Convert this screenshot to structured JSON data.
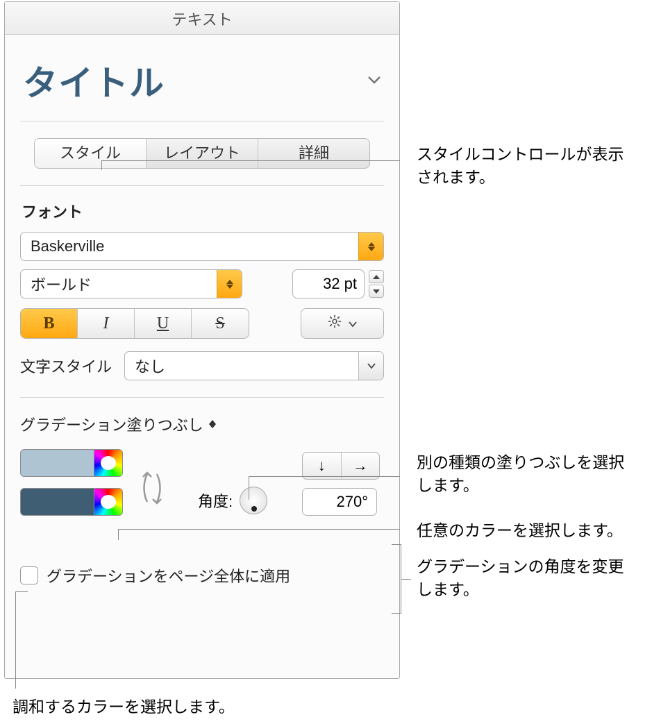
{
  "panel_title": "テキスト",
  "paragraph_style": "タイトル",
  "tabs": {
    "style": "スタイル",
    "layout": "レイアウト",
    "more": "詳細"
  },
  "font": {
    "section_label": "フォント",
    "family": "Baskerville",
    "weight": "ボールド",
    "size": "32 pt",
    "bold": "B",
    "italic": "I",
    "underline": "U",
    "strike": "S"
  },
  "char_style": {
    "label": "文字スタイル",
    "value": "なし"
  },
  "fill": {
    "type_label": "グラデーション塗りつぶし",
    "color1": "#aec4d3",
    "color2": "#3f5d73",
    "angle_label": "角度:",
    "angle_value": "270°",
    "apply_to_page_label": "グラデーションをページ全体に適用"
  },
  "annotations": {
    "style_tab": "スタイルコントロールが表示されます。",
    "fill_type": "別の種類の塗りつぶしを選択します。",
    "any_color": "任意のカラーを選択します。",
    "angle": "グラデーションの角度を変更します。",
    "match_color": "調和するカラーを選択します。"
  }
}
